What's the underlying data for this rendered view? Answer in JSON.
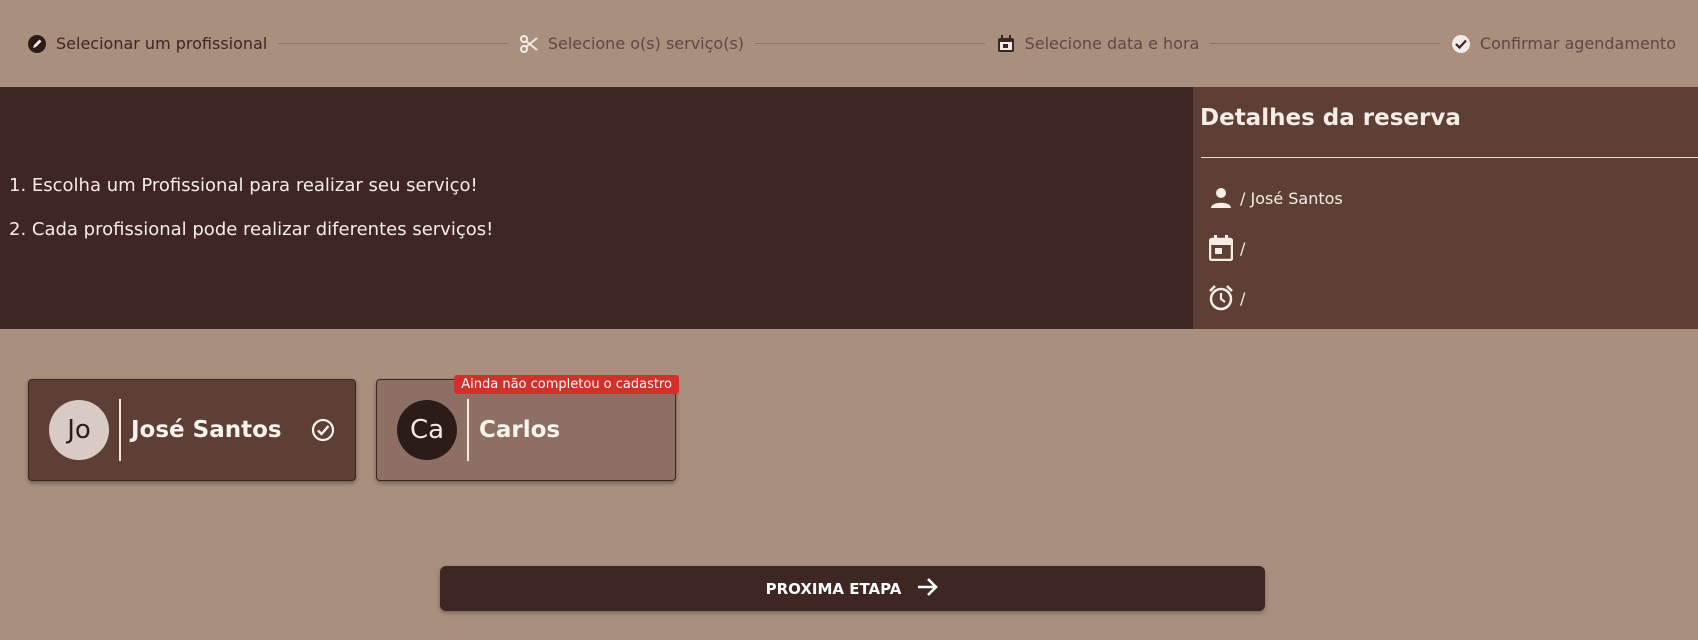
{
  "stepper": {
    "steps": [
      {
        "label": "Selecionar um profissional",
        "icon": "edit-circle-icon",
        "active": true
      },
      {
        "label": "Selecione o(s) serviço(s)",
        "icon": "scissors-icon",
        "active": false
      },
      {
        "label": "Selecione data e hora",
        "icon": "calendar-icon",
        "active": false
      },
      {
        "label": "Confirmar agendamento",
        "icon": "check-badge-icon",
        "active": false
      }
    ]
  },
  "instructions": {
    "line1": "1. Escolha um Profissional para realizar seu serviço!",
    "line2": "2. Cada profissional pode realizar diferentes serviços!"
  },
  "details": {
    "title": "Detalhes da reserva",
    "professional": "/ José Santos",
    "date": "/",
    "time": "/"
  },
  "professionals": [
    {
      "initials": "Jo",
      "name": "José Santos",
      "selected": true,
      "badge": ""
    },
    {
      "initials": "Ca",
      "name": "Carlos",
      "selected": false,
      "badge": "Ainda não completou o cadastro"
    }
  ],
  "next_button": {
    "label": "PROXIMA ETAPA"
  },
  "colors": {
    "page_background": "#a88f7e",
    "primary_dark": "#3e2622",
    "panel": "#5d3f36",
    "badge": "#d3302c"
  }
}
